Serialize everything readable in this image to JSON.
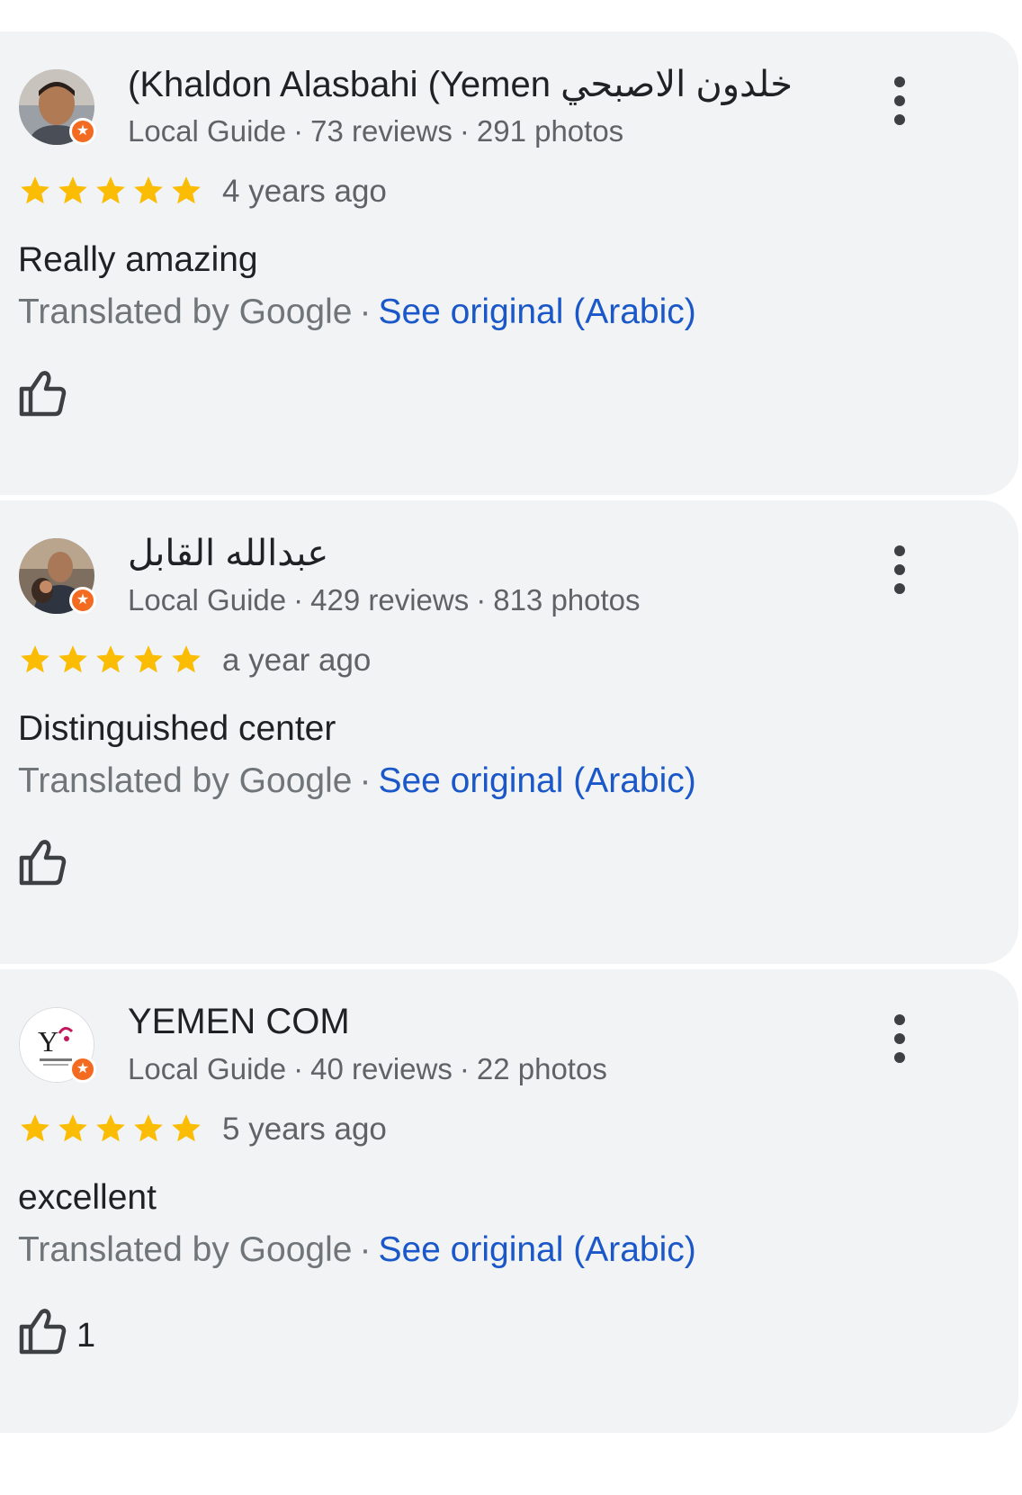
{
  "reviews": [
    {
      "name": "(Khaldon Alasbahi (Yemen خلدون الاصبحي",
      "guide_label": "Local Guide",
      "reviews_count": "73 reviews",
      "photos_count": "291 photos",
      "rating": 5,
      "time": "4 years ago",
      "text": "Really amazing",
      "translated_label": "Translated by Google",
      "see_original": "See original (Arabic)",
      "likes": ""
    },
    {
      "name": "عبدالله القابل",
      "guide_label": "Local Guide",
      "reviews_count": "429 reviews",
      "photos_count": "813 photos",
      "rating": 5,
      "time": "a year ago",
      "text": "Distinguished center",
      "translated_label": "Translated by Google",
      "see_original": "See original (Arabic)",
      "likes": ""
    },
    {
      "name": "YEMEN COM",
      "guide_label": "Local Guide",
      "reviews_count": "40 reviews",
      "photos_count": "22 photos",
      "rating": 5,
      "time": "5 years ago",
      "text": "excellent",
      "translated_label": "Translated by Google",
      "see_original": "See original (Arabic)",
      "likes": "1"
    }
  ],
  "colors": {
    "card_bg": "#f1f3f4",
    "star": "#fbbc04",
    "link": "#1a57c8",
    "badge": "#f36b21"
  },
  "icons": {
    "badge": "local-guide-star-icon",
    "menu": "more-vert-icon",
    "like": "thumb-up-icon",
    "star": "star-icon"
  }
}
